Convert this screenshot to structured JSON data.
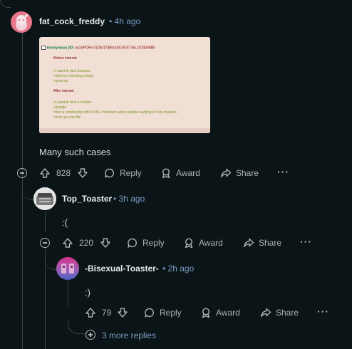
{
  "comments": [
    {
      "username": "fat_cock_freddy",
      "time": "• 4h ago",
      "body": "Many such cases",
      "score": "828",
      "reply": "Reply",
      "award": "Award",
      "share": "Share",
      "image": {
        "header_name": "Anonymous (ID:",
        "header_id": "no2oPOFe",
        "header_date": "01/16/17(Mon)18:36:57 No.107430086",
        "before_title": "Before internet",
        "before_lines": [
          ">I want to fuck toasters",
          ">dont be a fucking retard",
          ">grow up"
        ],
        "after_title": "After internet",
        "after_lines": [
          ">I want to fuck a toaster",
          ">google",
          ">find a community with 1000+ members about people wanting to fuck toasters",
          ">fuck up your life"
        ]
      }
    },
    {
      "username": "Top_Toaster",
      "time": "• 3h ago",
      "body": ":(",
      "score": "220",
      "reply": "Reply",
      "award": "Award",
      "share": "Share"
    },
    {
      "username": "-Bisexual-Toaster-",
      "time": "• 2h ago",
      "body": ":)",
      "score": "79",
      "reply": "Reply",
      "award": "Award",
      "share": "Share",
      "more_replies": "3 more replies"
    }
  ],
  "colors": {
    "background": "#0b1416",
    "username": "#e8eaec",
    "timestamp": "#7b9cc4",
    "muted": "#aab4b8",
    "thread_line": "#3a4548"
  }
}
